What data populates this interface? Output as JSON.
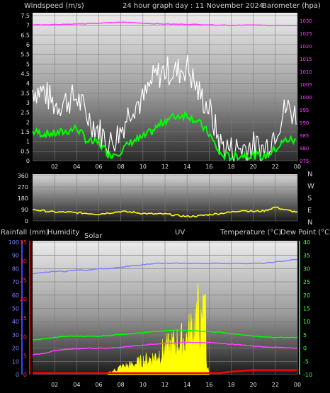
{
  "colors": {
    "wind_avg": "#00ff00",
    "wind_gust": "#ffffff",
    "barometer": "#ff40ff",
    "direction": "#ffff00",
    "humidity": "#8080ff",
    "temperature": "#00ff00",
    "dewpoint": "#ff40ff",
    "solar": "#ffff00",
    "rainfall": "#ff0000",
    "uv": "#ff2020",
    "axis_rain": "#ff0000",
    "axis_humidity": "#4040ff",
    "axis_temp": "#00ff00"
  },
  "header": {
    "windspeed_label": "Windspeed (m/s)",
    "graph_title": "24 hour graph day : 11 November 2024",
    "barometer_label": "Barometer (hpa)"
  },
  "direction_labels": [
    "N",
    "W",
    "S",
    "E",
    "N"
  ],
  "bottom_labels": {
    "rainfall": "Rainfall (mm)",
    "humidity": "Humidity",
    "solar": "Solar",
    "uv": "UV",
    "temperature": "Temperature (°C)",
    "dewpoint": "Dew Point (°C)"
  },
  "x_ticks": [
    "02",
    "04",
    "06",
    "08",
    "10",
    "12",
    "14",
    "16",
    "18",
    "20",
    "22",
    "00"
  ],
  "chart_data": [
    {
      "type": "line",
      "title": "24 hour graph day : 11 November 2024",
      "x_unit": "hour",
      "x": [
        0,
        1,
        2,
        3,
        4,
        5,
        6,
        7,
        8,
        9,
        10,
        11,
        12,
        13,
        14,
        15,
        16,
        17,
        18,
        19,
        20,
        21,
        22,
        23,
        24
      ],
      "yticks_left": [
        "0",
        "0.5",
        "1",
        "1.5",
        "2",
        "2.5",
        "3",
        "3.5",
        "4",
        "4.5",
        "5",
        "5.5",
        "6",
        "6.5",
        "7",
        "7.5"
      ],
      "ylim_left": [
        0,
        7.5
      ],
      "yticks_right": [
        "975",
        "980",
        "985",
        "990",
        "995",
        "1000",
        "1005",
        "1010",
        "1015",
        "1020",
        "1025",
        "1030"
      ],
      "ylim_right": [
        975,
        1032
      ],
      "series": [
        {
          "name": "Windspeed (m/s)",
          "axis": "left",
          "values": [
            1.5,
            1.4,
            1.4,
            1.5,
            1.7,
            1.0,
            0.9,
            0.3,
            0.5,
            1.0,
            1.2,
            1.6,
            2.1,
            2.3,
            2.4,
            2.0,
            1.4,
            0.3,
            0.2,
            0.3,
            0.3,
            0.2,
            0.6,
            1.1,
            1.0
          ]
        },
        {
          "name": "Gust (m/s)",
          "axis": "left",
          "values": [
            3.6,
            3.5,
            2.8,
            3.0,
            3.2,
            2.2,
            1.5,
            0.8,
            1.5,
            2.8,
            3.0,
            4.2,
            4.6,
            4.5,
            4.8,
            3.5,
            2.6,
            0.8,
            0.5,
            0.6,
            0.7,
            0.5,
            1.5,
            2.7,
            2.2
          ]
        },
        {
          "name": "Barometer (hpa)",
          "axis": "right",
          "values": [
            1028.4,
            1028.4,
            1028.5,
            1028.6,
            1028.7,
            1028.8,
            1029.0,
            1029.2,
            1029.4,
            1029.3,
            1029.0,
            1028.8,
            1028.7,
            1028.6,
            1028.6,
            1028.5,
            1028.4,
            1028.3,
            1028.2,
            1028.3,
            1028.3,
            1028.2,
            1028.2,
            1028.1,
            1028.1
          ]
        }
      ]
    },
    {
      "type": "line",
      "x_unit": "hour",
      "x": [
        0,
        1,
        2,
        3,
        4,
        5,
        6,
        7,
        8,
        9,
        10,
        11,
        12,
        13,
        14,
        15,
        16,
        17,
        18,
        19,
        20,
        21,
        22,
        23,
        24
      ],
      "yticks": [
        "0",
        "90",
        "180",
        "270",
        "360"
      ],
      "ylim": [
        0,
        360
      ],
      "series": [
        {
          "name": "Wind direction (°)",
          "values": [
            90,
            80,
            70,
            70,
            65,
            60,
            55,
            65,
            75,
            70,
            60,
            55,
            55,
            45,
            35,
            40,
            50,
            60,
            70,
            85,
            75,
            80,
            110,
            85,
            70
          ]
        }
      ]
    },
    {
      "type": "line",
      "x_unit": "hour",
      "x": [
        0,
        1,
        2,
        3,
        4,
        5,
        6,
        7,
        8,
        9,
        10,
        11,
        12,
        13,
        14,
        15,
        16,
        17,
        18,
        19,
        20,
        21,
        22,
        23,
        24
      ],
      "yticks_rain": [
        "0",
        "5",
        "10",
        "15",
        "20",
        "25",
        "30",
        "35"
      ],
      "ylim_rain": [
        0,
        35
      ],
      "yticks_humidity": [
        "0",
        "10",
        "20",
        "30",
        "40",
        "50",
        "60",
        "70",
        "80",
        "90",
        "100"
      ],
      "ylim_humidity": [
        0,
        100
      ],
      "yticks_temp": [
        "-10",
        "-5",
        "0",
        "5",
        "10",
        "15",
        "20",
        "25",
        "30",
        "35",
        "40"
      ],
      "ylim_temp": [
        -10,
        40
      ],
      "series": [
        {
          "name": "Humidity",
          "axis": "humidity",
          "values": [
            76,
            77,
            78,
            78,
            79,
            79,
            80,
            80,
            81,
            82,
            83,
            84,
            84,
            84,
            84,
            84,
            84,
            84,
            84,
            84,
            84,
            84,
            85,
            86,
            87
          ]
        },
        {
          "name": "Temperature (°C)",
          "axis": "temp",
          "values": [
            3.0,
            3.5,
            4.0,
            4.5,
            4.5,
            4.5,
            4.5,
            4.8,
            5.2,
            5.5,
            5.8,
            6.2,
            6.5,
            6.8,
            6.8,
            6.5,
            6.2,
            6.0,
            5.5,
            5.0,
            4.5,
            4.2,
            4.0,
            4.0,
            4.0
          ]
        },
        {
          "name": "Dew Point (°C)",
          "axis": "temp",
          "values": [
            -2.5,
            -2.0,
            -1.0,
            -0.5,
            -0.3,
            0,
            0,
            0,
            0.3,
            0.8,
            1.2,
            1.5,
            1.8,
            2.0,
            2.2,
            2.2,
            2.0,
            1.8,
            1.5,
            1.2,
            0.8,
            0.5,
            0.3,
            0.2,
            0
          ]
        },
        {
          "name": "Solar",
          "axis": "humidity",
          "values": [
            0,
            0,
            0,
            0,
            0,
            0,
            0,
            2,
            7,
            9,
            13,
            16,
            24,
            30,
            34,
            58,
            0,
            0,
            0,
            0,
            0,
            0,
            0,
            0,
            0
          ]
        },
        {
          "name": "Rainfall (mm)",
          "axis": "rain",
          "values": [
            0.4,
            0.4,
            0.4,
            0.4,
            0.4,
            0.4,
            0.4,
            0.4,
            0.4,
            0.4,
            0.4,
            0.4,
            0.4,
            0.4,
            0.4,
            0.4,
            0.4,
            0.4,
            0.8,
            1.0,
            1.2,
            1.2,
            1.2,
            1.2,
            1.2
          ]
        }
      ]
    }
  ]
}
